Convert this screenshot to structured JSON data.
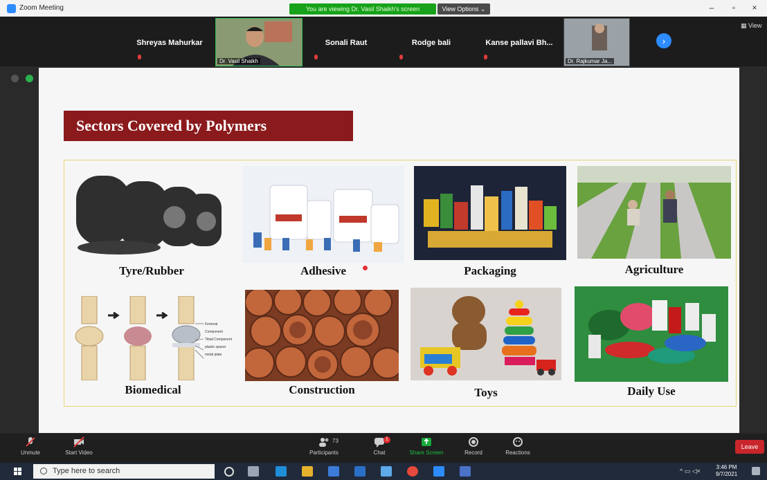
{
  "window": {
    "title": "Zoom Meeting",
    "viewing_banner": "You are viewing Dr. Vasil Shaikh's screen",
    "view_options": "View Options ⌄",
    "minimize": "–",
    "maximize": "▫",
    "close": "×"
  },
  "participants": {
    "names": [
      "Shreyas Mahurkar",
      "Sonali Raut",
      "Rodge bali",
      "Kanse pallavi Bh..."
    ],
    "video_tiles": [
      {
        "label": "Dr. Vasil Shaikh"
      },
      {
        "label": "Dr. Rajkumar Ja..."
      }
    ],
    "view_label": "▦ View"
  },
  "slide": {
    "title": "Sectors Covered by Polymers",
    "sectors": [
      {
        "label": "Tyre/Rubber",
        "icon": "tyres-photo"
      },
      {
        "label": "Adhesive",
        "icon": "adhesive-containers-photo"
      },
      {
        "label": "Packaging",
        "icon": "packaged-goods-photo"
      },
      {
        "label": "Agriculture",
        "icon": "mulch-field-photo"
      },
      {
        "label": "Biomedical",
        "icon": "knee-implant-illustration"
      },
      {
        "label": "Construction",
        "icon": "pipes-photo"
      },
      {
        "label": "Toys",
        "icon": "plastic-toys-photo"
      },
      {
        "label": "Daily Use",
        "icon": "disposable-tableware-photo"
      }
    ],
    "knee_annotations": [
      "Femoral Component",
      "Tibial Component",
      "plastic spacer",
      "metal plate"
    ]
  },
  "controls": {
    "unmute": "Unmute",
    "start_video": "Start Video",
    "participants": "Participants",
    "participant_count": "73",
    "chat": "Chat",
    "chat_badge": "1",
    "share_screen": "Share Screen",
    "record": "Record",
    "reactions": "Reactions",
    "leave": "Leave"
  },
  "taskbar": {
    "search_placeholder": "Type here to search",
    "time": "3:46 PM",
    "date": "9/7/2021"
  },
  "colors": {
    "title_bg": "#8a1a1c",
    "zoom_blue": "#2d8cff",
    "share_green": "#18a21b",
    "leave_red": "#c8262b"
  }
}
